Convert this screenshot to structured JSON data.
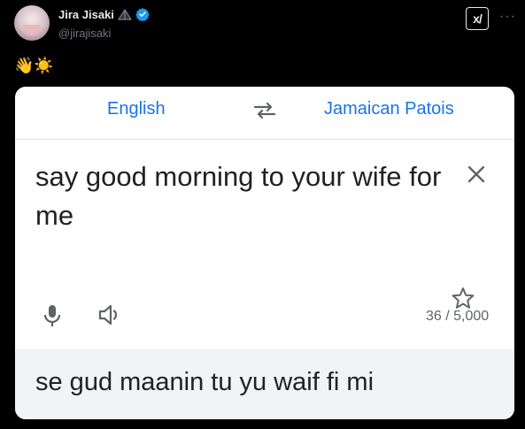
{
  "post": {
    "author_name": "Jira Jisaki",
    "handle": "@jirajisaki",
    "text_emojis": "👋☀️",
    "xai_label": "x/",
    "more_label": "···"
  },
  "translator": {
    "source_language": "English",
    "target_language": "Jamaican Patois",
    "source_text": "say good morning to your wife for me",
    "char_count": "36 / 5,000",
    "translation": "se gud maanin tu yu waif fi mi"
  },
  "colors": {
    "accent": "#1a73e8",
    "verified": "#1d9bf0",
    "page_background": "#000000",
    "card_background": "#ffffff",
    "result_background": "#f1f3f4"
  },
  "icons": [
    "verified-icon",
    "flag-icon",
    "swap-icon",
    "clear-icon",
    "mic-icon",
    "speaker-icon",
    "star-icon"
  ]
}
